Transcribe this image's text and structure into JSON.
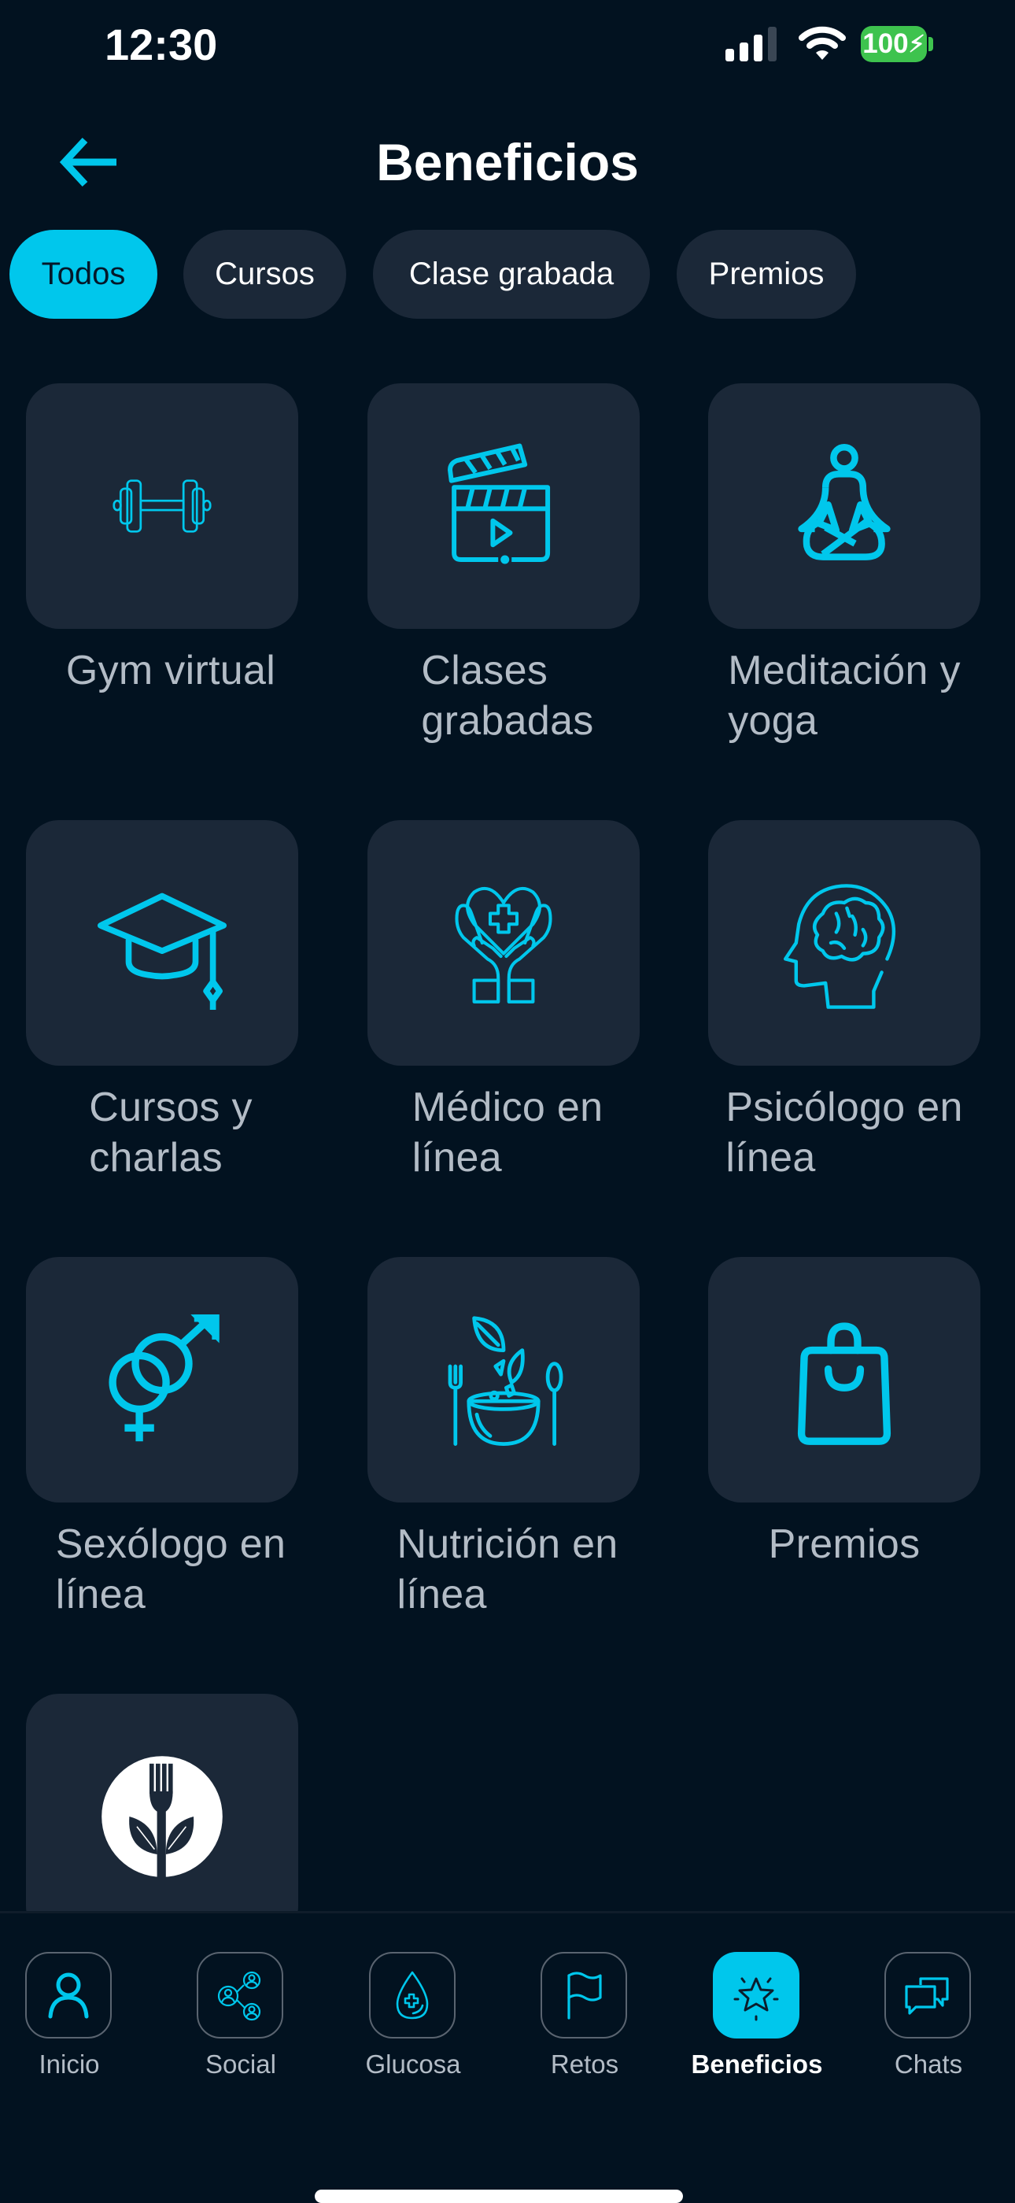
{
  "status_bar": {
    "time": "12:30",
    "battery_percent": "100",
    "signal_bars_active": 3,
    "signal_bars_total": 4,
    "icons": [
      "cellular-signal-icon",
      "wifi-icon",
      "battery-charging-icon"
    ]
  },
  "header": {
    "title": "Beneficios",
    "back_icon": "arrow-left-icon"
  },
  "filters": {
    "selected": "Todos",
    "chips": [
      {
        "label": "Todos",
        "active": true
      },
      {
        "label": "Cursos",
        "active": false
      },
      {
        "label": "Clase grabada",
        "active": false
      },
      {
        "label": "Premios",
        "active": false
      }
    ]
  },
  "benefits": [
    {
      "label": "Gym virtual",
      "icon": "dumbbell-icon"
    },
    {
      "label": "Clases grabadas",
      "icon": "clapperboard-icon"
    },
    {
      "label": "Meditación y yoga",
      "icon": "meditation-icon"
    },
    {
      "label": "Cursos y charlas",
      "icon": "graduation-cap-icon"
    },
    {
      "label": "Médico en línea",
      "icon": "hands-heart-cross-icon"
    },
    {
      "label": "Psicólogo en línea",
      "icon": "head-brain-icon"
    },
    {
      "label": "Sexólogo en línea",
      "icon": "gender-symbols-icon"
    },
    {
      "label": "Nutrición en línea",
      "icon": "salad-bowl-icon"
    },
    {
      "label": "Premios",
      "icon": "shopping-bag-icon"
    },
    {
      "label": "",
      "icon": "fork-leaves-logo-icon"
    }
  ],
  "labels_lines": [
    [
      "Gym virtual"
    ],
    [
      "Clases",
      "grabadas"
    ],
    [
      "Meditación y",
      "yoga"
    ],
    [
      "Cursos y",
      "charlas"
    ],
    [
      "Médico en",
      "línea"
    ],
    [
      "Psicólogo en",
      "línea"
    ],
    [
      "Sexólogo en",
      "línea"
    ],
    [
      "Nutrición en",
      "línea"
    ],
    [
      "Premios"
    ]
  ],
  "bottom_nav": [
    {
      "label": "Inicio",
      "icon": "user-icon",
      "active": false
    },
    {
      "label": "Social",
      "icon": "social-network-icon",
      "active": false
    },
    {
      "label": "Glucosa",
      "icon": "blood-drop-icon",
      "active": false
    },
    {
      "label": "Retos",
      "icon": "flag-icon",
      "active": false
    },
    {
      "label": "Beneficios",
      "icon": "star-icon",
      "active": true
    },
    {
      "label": "Chats",
      "icon": "chat-bubbles-icon",
      "active": false
    }
  ],
  "colors": {
    "background": "#021220",
    "card": "#1b2838",
    "accent": "#00c7ec",
    "label_text": "#b3bcc6",
    "battery": "#3ec34e"
  }
}
